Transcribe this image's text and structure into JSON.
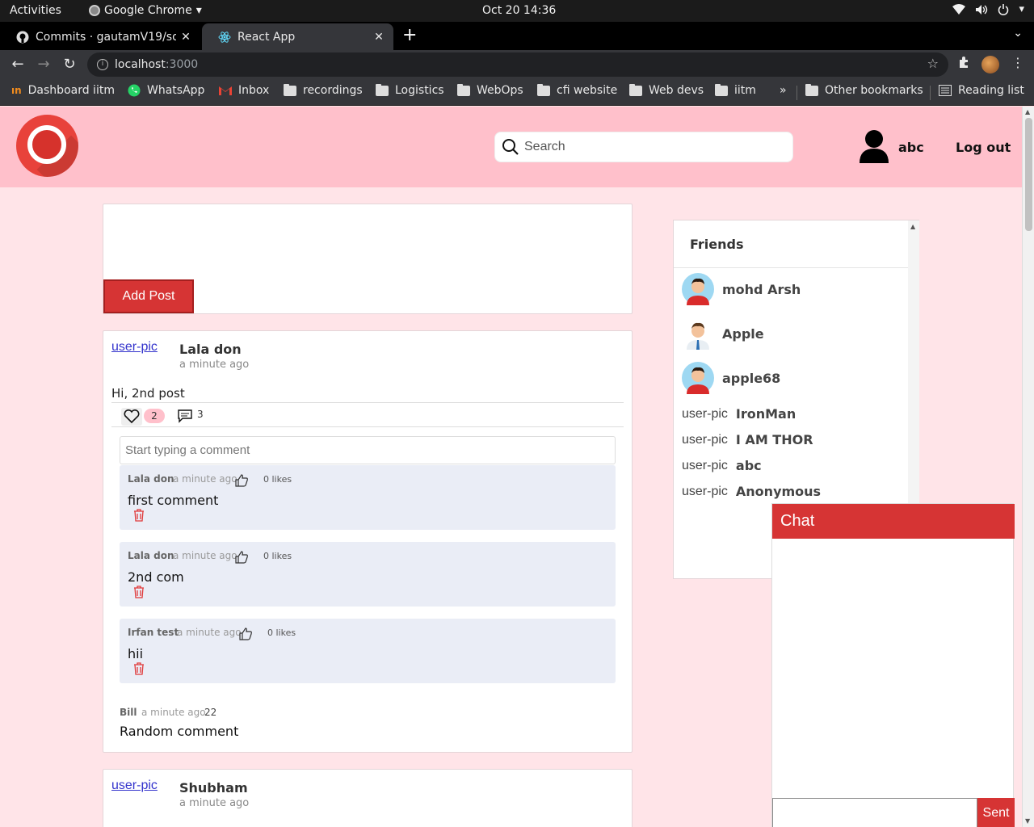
{
  "system": {
    "activities": "Activities",
    "app_name": "Google Chrome",
    "clock": "Oct 20  14:36"
  },
  "browser": {
    "tabs": [
      {
        "title": "Commits · gautamV19/so",
        "active": false
      },
      {
        "title": "React App",
        "active": true
      }
    ],
    "url_host": "localhost",
    "url_port": ":3000",
    "bookmarks": [
      "Dashboard iitm",
      "WhatsApp",
      "Inbox",
      "recordings",
      "Logistics",
      "WebOps",
      "cfi website",
      "Web devs",
      "iitm"
    ],
    "more_bookmarks": "»",
    "other_bookmarks": "Other bookmarks",
    "reading_list": "Reading list"
  },
  "header": {
    "search_placeholder": "Search",
    "username": "abc",
    "logout": "Log out"
  },
  "addpost": {
    "button": "Add Post"
  },
  "posts": [
    {
      "pic_alt": "user-pic",
      "author": "Lala don",
      "time": "a minute ago",
      "content": "Hi, 2nd post",
      "likes": "2",
      "comments_count": "3",
      "comment_placeholder": "Start typing a comment",
      "comments": [
        {
          "author": "Lala don",
          "time": "a minute ago",
          "likes": "0 likes",
          "text": "first comment"
        },
        {
          "author": "Lala don",
          "time": "a minute ago",
          "likes": "0 likes",
          "text": "2nd com"
        },
        {
          "author": "Irfan test",
          "time": "a minute ago",
          "likes": "0 likes",
          "text": "hii"
        }
      ],
      "extra_comment": {
        "author": "Bill",
        "time": "a minute ago",
        "num": "22",
        "text": "Random comment"
      }
    },
    {
      "pic_alt": "user-pic",
      "author": "Shubham",
      "time": "a minute ago"
    }
  ],
  "friends": {
    "title": "Friends",
    "with_avatar": [
      "mohd Arsh",
      "Apple",
      "apple68"
    ],
    "broken_pic_alt": "user-pic",
    "without_avatar": [
      "IronMan",
      "I AM THOR",
      "abc",
      "Anonymous"
    ]
  },
  "chat": {
    "title": "Chat",
    "send": "Sent"
  },
  "colors": {
    "header_bg": "#ffc0cb",
    "page_bg": "#ffe4e8",
    "accent_red": "#d63434"
  }
}
